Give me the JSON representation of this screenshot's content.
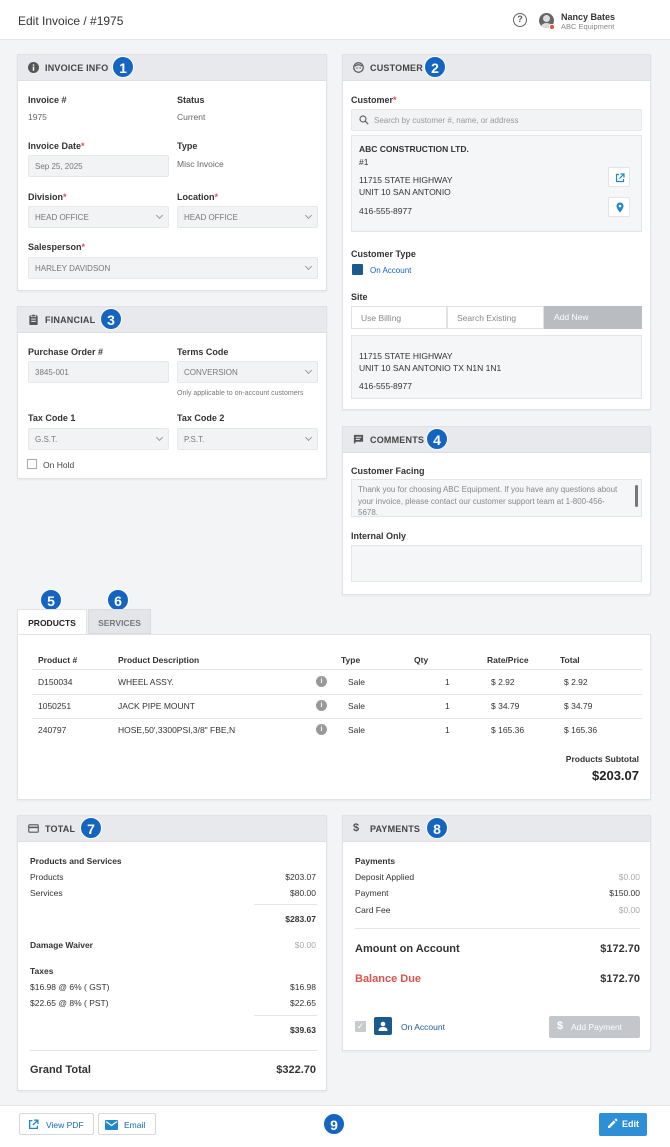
{
  "header": {
    "title": "Edit Invoice / #1975",
    "help": "?",
    "user_name": "Nancy Bates",
    "user_company": "ABC Equipment"
  },
  "badges": [
    "1",
    "2",
    "3",
    "4",
    "5",
    "6",
    "7",
    "8",
    "9"
  ],
  "invoice_info": {
    "heading": "INVOICE INFO",
    "invoice_no_label": "Invoice #",
    "invoice_no": "1975",
    "status_label": "Status",
    "status": "Current",
    "date_label": "Invoice Date",
    "date": "Sep 25, 2025",
    "type_label": "Type",
    "type": "Misc Invoice",
    "division_label": "Division",
    "division": "HEAD OFFICE",
    "location_label": "Location",
    "location": "HEAD OFFICE",
    "salesperson_label": "Salesperson",
    "salesperson": "HARLEY DAVIDSON",
    "required_mark": "*"
  },
  "financial": {
    "heading": "FINANCIAL",
    "po_label": "Purchase Order #",
    "po": "3845-001",
    "terms_label": "Terms Code",
    "terms": "CONVERSION",
    "terms_note": "Only applicable to on-account customers",
    "tax1_label": "Tax Code 1",
    "tax1": "G.S.T.",
    "tax2_label": "Tax Code 2",
    "tax2": "P.S.T.",
    "on_hold_label": "On Hold"
  },
  "customer": {
    "heading": "CUSTOMER",
    "customer_label": "Customer",
    "search_placeholder": "Search by customer #, name, or address",
    "name": "ABC CONSTRUCTION LTD.",
    "number": "#1",
    "address1": "11715 STATE HIGHWAY",
    "address2": "UNIT 10 SAN ANTONIO",
    "phone": "416-555-8977",
    "type_label": "Customer Type",
    "type_value": "On Account",
    "site_label": "Site",
    "site_tabs": [
      "Use Billing",
      "Search Existing",
      "Add New"
    ],
    "site_address1": "11715 STATE HIGHWAY",
    "site_address2": "UNIT 10 SAN ANTONIO TX N1N 1N1",
    "site_phone": "416-555-8977"
  },
  "comments": {
    "heading": "COMMENTS",
    "customer_facing_label": "Customer Facing",
    "customer_facing_text": "Thank you for choosing ABC Equipment. If you have any questions about your invoice, please contact our customer support team at 1-800-456-5678.",
    "internal_label": "Internal Only"
  },
  "tabs": [
    "PRODUCTS",
    "SERVICES"
  ],
  "products": {
    "columns": [
      "Product #",
      "Product Description",
      "Type",
      "Qty",
      "Rate/Price",
      "Total"
    ],
    "rows": [
      {
        "num": "D150034",
        "desc": "WHEEL ASSY.",
        "type": "Sale",
        "qty": "1",
        "rate": "$ 2.92",
        "total": "$ 2.92"
      },
      {
        "num": "1050251",
        "desc": "JACK PIPE MOUNT",
        "type": "Sale",
        "qty": "1",
        "rate": "$ 34.79",
        "total": "$ 34.79"
      },
      {
        "num": "240797",
        "desc": "HOSE,50',3300PSI,3/8\" FBE,N",
        "type": "Sale",
        "qty": "1",
        "rate": "$ 165.36",
        "total": "$ 165.36"
      }
    ],
    "subtotal_label": "Products Subtotal",
    "subtotal": "$203.07"
  },
  "total": {
    "heading": "TOTAL",
    "section_label": "Products and Services",
    "products_label": "Products",
    "products": "$203.07",
    "services_label": "Services",
    "services": "$80.00",
    "ps_sum": "$283.07",
    "damage_label": "Damage Waiver",
    "damage": "$0.00",
    "taxes_label": "Taxes",
    "tax1_label": "$16.98 @ 6% ( GST)",
    "tax1": "$16.98",
    "tax2_label": "$22.65 @ 8% ( PST)",
    "tax2": "$22.65",
    "tax_sum": "$39.63",
    "grand_label": "Grand Total",
    "grand": "$322.70"
  },
  "payments": {
    "heading": "PAYMENTS",
    "section_label": "Payments",
    "deposit_label": "Deposit Applied",
    "deposit": "$0.00",
    "payment_label": "Payment",
    "payment": "$150.00",
    "card_fee_label": "Card Fee",
    "card_fee": "$0.00",
    "account_label": "Amount on Account",
    "account": "$172.70",
    "balance_label": "Balance Due",
    "balance": "$172.70",
    "on_account_label": "On Account",
    "add_payment": "Add Payment"
  },
  "footer": {
    "view_pdf": "View PDF",
    "email": "Email",
    "edit": "Edit"
  },
  "colors": {
    "badge": "#1565c0",
    "balance": "#d9534f",
    "edit_button": "#2e8fd6",
    "link": "#1565c0"
  }
}
